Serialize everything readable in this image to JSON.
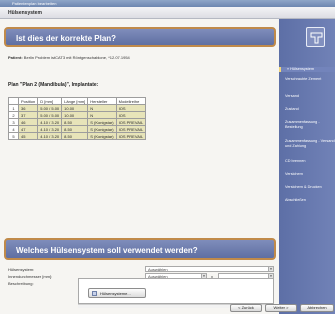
{
  "window": {
    "title": "Patientenplan bearbeiten"
  },
  "app": {
    "title": "Hülsensystem"
  },
  "question_banner": "Ist dies der korrekte Plan?",
  "patient": {
    "label": "Patient:",
    "value": "Berlin Problem istCAT3 mit Röntgenschablone, *12.07.1954"
  },
  "plan": {
    "label": "Plan \"Plan 2 (Mandibula)\", Implantate:"
  },
  "implant_table": {
    "columns": [
      "",
      "Position",
      "D [mm]",
      "Länge [mm]",
      "Hersteller",
      "Modellreihe"
    ],
    "rows": [
      [
        "1",
        "36",
        "5.00 / 5.00",
        "10.00",
        "N",
        "IOS"
      ],
      [
        "2",
        "37",
        "5.00 / 5.00",
        "10.00",
        "N",
        "IOS"
      ],
      [
        "3",
        "46",
        "4.10 / 3.20",
        "8.50",
        "S (Konigstar)",
        "IOS PREVAIL"
      ],
      [
        "4",
        "47",
        "4.10 / 3.20",
        "8.50",
        "S (Konigstar)",
        "IOS PREVAIL"
      ],
      [
        "5",
        "45",
        "4.10 / 3.20",
        "8.50",
        "S (Konigstar)",
        "IOS PREVAIL"
      ]
    ]
  },
  "sleeve_banner": "Welches Hülsensystem soll verwendet werden?",
  "form": {
    "system_label": "Hülsensystem:",
    "system_value": "Auswählen",
    "diameter_label": "Innendurchmesser [mm]:",
    "diameter_value": "Auswählen",
    "diameter_sep": "x",
    "description_label": "Beschreibung:"
  },
  "buttons": {
    "sleeve_systems": "Hülsensysteme...",
    "back": "< Zurück",
    "next": "Weiter >",
    "cancel": "Abbrechen"
  },
  "sidebar": {
    "items": [
      {
        "label": "» Hülsensystem",
        "active": true
      },
      {
        "label": "Verschraubte Zement",
        "active": false
      },
      {
        "label": "Versand",
        "active": false
      },
      {
        "label": "Zustand",
        "active": false
      },
      {
        "label": "Zusammenfassung - Bestellung",
        "active": false
      },
      {
        "label": "Zusammenfassung - Versand und Zahlung",
        "active": false
      },
      {
        "label": "CD brennen",
        "active": false
      },
      {
        "label": "Versichern",
        "active": false
      },
      {
        "label": "Versichern & Drucken",
        "active": false
      },
      {
        "label": "Abschließen",
        "active": false
      }
    ]
  },
  "colors": {
    "sidebar": "#6677ad",
    "banner": "#6f7db0",
    "banner_border": "#c08a4a",
    "table_row": "#e7e4b9",
    "active_marker": "#f2d67a"
  }
}
